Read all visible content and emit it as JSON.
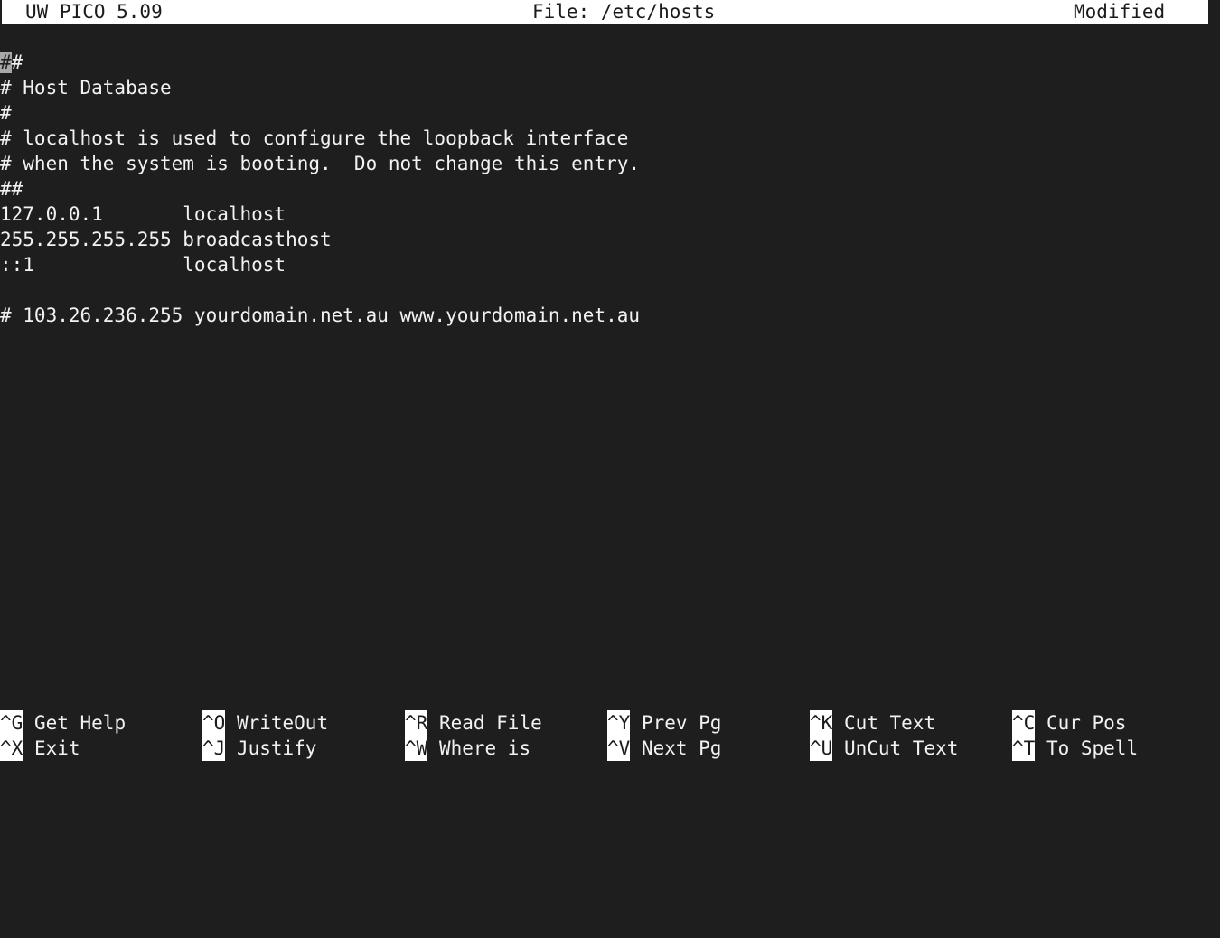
{
  "titlebar": {
    "app": "UW PICO 5.09",
    "file": "File: /etc/hosts",
    "status": "Modified"
  },
  "editor": {
    "cursor_char": "#",
    "lines": [
      "#",
      "# Host Database",
      "#",
      "# localhost is used to configure the loopback interface",
      "# when the system is booting.  Do not change this entry.",
      "##",
      "127.0.0.1       localhost",
      "255.255.255.255 broadcasthost",
      "::1             localhost",
      "",
      "# 103.26.236.255 yourdomain.net.au www.yourdomain.net.au"
    ],
    "first_line_remainder": "#"
  },
  "helpbar": {
    "row1": [
      {
        "key": "^G",
        "label": " Get Help"
      },
      {
        "key": "^O",
        "label": " WriteOut"
      },
      {
        "key": "^R",
        "label": " Read File"
      },
      {
        "key": "^Y",
        "label": " Prev Pg"
      },
      {
        "key": "^K",
        "label": " Cut Text"
      },
      {
        "key": "^C",
        "label": " Cur Pos"
      }
    ],
    "row2": [
      {
        "key": "^X",
        "label": " Exit"
      },
      {
        "key": "^J",
        "label": " Justify"
      },
      {
        "key": "^W",
        "label": " Where is"
      },
      {
        "key": "^V",
        "label": " Next Pg"
      },
      {
        "key": "^U",
        "label": " UnCut Text"
      },
      {
        "key": "^T",
        "label": " To Spell"
      }
    ]
  },
  "colors": {
    "background": "#1e1e1e",
    "foreground": "#f2f2f2",
    "inverse_bg": "#ffffff",
    "inverse_fg": "#1b1b1b",
    "cursor_bg": "#a8a8a8"
  }
}
